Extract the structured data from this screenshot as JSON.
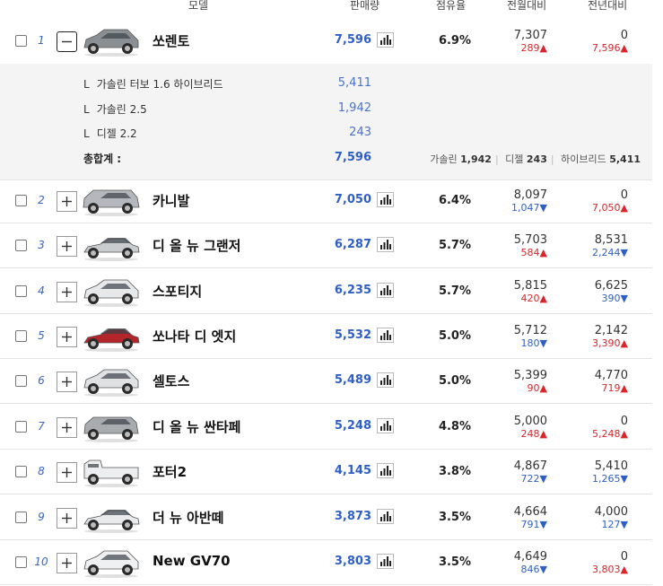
{
  "headers": {
    "model": "모델",
    "sales": "판매량",
    "share": "점유율",
    "mom": "전월대비",
    "yoy": "전년대비"
  },
  "expanded": {
    "sub_items": [
      {
        "marker": "L",
        "name": "가솔린 터보 1.6 하이브리드",
        "value": "5,411"
      },
      {
        "marker": "L",
        "name": "가솔린 2.5",
        "value": "1,942"
      },
      {
        "marker": "L",
        "name": "디젤 2.2",
        "value": "243"
      }
    ],
    "total_label": "총합계 :",
    "total_value": "7,596",
    "breakdown": [
      {
        "label": "가솔린",
        "value": "1,942"
      },
      {
        "label": "디젤",
        "value": "243"
      },
      {
        "label": "하이브리드",
        "value": "5,411"
      }
    ]
  },
  "rows": [
    {
      "rank": "1",
      "name": "쏘렌토",
      "sales": "7,596",
      "share": "6.9%",
      "mom_value": "7,307",
      "mom_delta": "289▲",
      "mom_dir": "up",
      "yoy_value": "0",
      "yoy_delta": "7,596▲",
      "yoy_dir": "up",
      "car_color": "#8a8f94",
      "car_type": "suv"
    },
    {
      "rank": "2",
      "name": "카니발",
      "sales": "7,050",
      "share": "6.4%",
      "mom_value": "8,097",
      "mom_delta": "1,047▼",
      "mom_dir": "down",
      "yoy_value": "0",
      "yoy_delta": "7,050▲",
      "yoy_dir": "up",
      "car_color": "#b4b8bc",
      "car_type": "van"
    },
    {
      "rank": "3",
      "name": "디 올 뉴 그랜저",
      "sales": "6,287",
      "share": "5.7%",
      "mom_value": "5,703",
      "mom_delta": "584▲",
      "mom_dir": "up",
      "yoy_value": "8,531",
      "yoy_delta": "2,244▼",
      "yoy_dir": "down",
      "car_color": "#c9ccce",
      "car_type": "sedan"
    },
    {
      "rank": "4",
      "name": "스포티지",
      "sales": "6,235",
      "share": "5.7%",
      "mom_value": "5,815",
      "mom_delta": "420▲",
      "mom_dir": "up",
      "yoy_value": "6,625",
      "yoy_delta": "390▼",
      "yoy_dir": "down",
      "car_color": "#e6e8ea",
      "car_type": "suv"
    },
    {
      "rank": "5",
      "name": "쏘나타 디 엣지",
      "sales": "5,532",
      "share": "5.0%",
      "mom_value": "5,712",
      "mom_delta": "180▼",
      "mom_dir": "down",
      "yoy_value": "2,142",
      "yoy_delta": "3,390▲",
      "yoy_dir": "up",
      "car_color": "#b3242b",
      "car_type": "sedan"
    },
    {
      "rank": "6",
      "name": "셀토스",
      "sales": "5,489",
      "share": "5.0%",
      "mom_value": "5,399",
      "mom_delta": "90▲",
      "mom_dir": "up",
      "yoy_value": "4,770",
      "yoy_delta": "719▲",
      "yoy_dir": "up",
      "car_color": "#dfe1e3",
      "car_type": "suv"
    },
    {
      "rank": "7",
      "name": "디 올 뉴 싼타페",
      "sales": "5,248",
      "share": "4.8%",
      "mom_value": "5,000",
      "mom_delta": "248▲",
      "mom_dir": "up",
      "yoy_value": "0",
      "yoy_delta": "5,248▲",
      "yoy_dir": "up",
      "car_color": "#a8acaf",
      "car_type": "boxy"
    },
    {
      "rank": "8",
      "name": "포터2",
      "sales": "4,145",
      "share": "3.8%",
      "mom_value": "4,867",
      "mom_delta": "722▼",
      "mom_dir": "down",
      "yoy_value": "5,410",
      "yoy_delta": "1,265▼",
      "yoy_dir": "down",
      "car_color": "#eceef0",
      "car_type": "truck"
    },
    {
      "rank": "9",
      "name": "더 뉴 아반떼",
      "sales": "3,873",
      "share": "3.5%",
      "mom_value": "4,664",
      "mom_delta": "791▼",
      "mom_dir": "down",
      "yoy_value": "4,000",
      "yoy_delta": "127▼",
      "yoy_dir": "down",
      "car_color": "#e8eaec",
      "car_type": "sedan"
    },
    {
      "rank": "10",
      "name": "New GV70",
      "sales": "3,803",
      "share": "3.5%",
      "mom_value": "4,649",
      "mom_delta": "846▼",
      "mom_dir": "down",
      "yoy_value": "0",
      "yoy_delta": "3,803▲",
      "yoy_dir": "up",
      "car_color": "#eef0f2",
      "car_type": "suv"
    }
  ],
  "colors": {
    "accent_blue": "#2f5fc4",
    "up_red": "#d9262c",
    "down_blue": "#2f5fc4",
    "detail_bg": "#f4f4f4"
  },
  "icons": {
    "expand": "plus-icon",
    "collapse": "minus-icon",
    "chart": "bar-chart-icon"
  }
}
